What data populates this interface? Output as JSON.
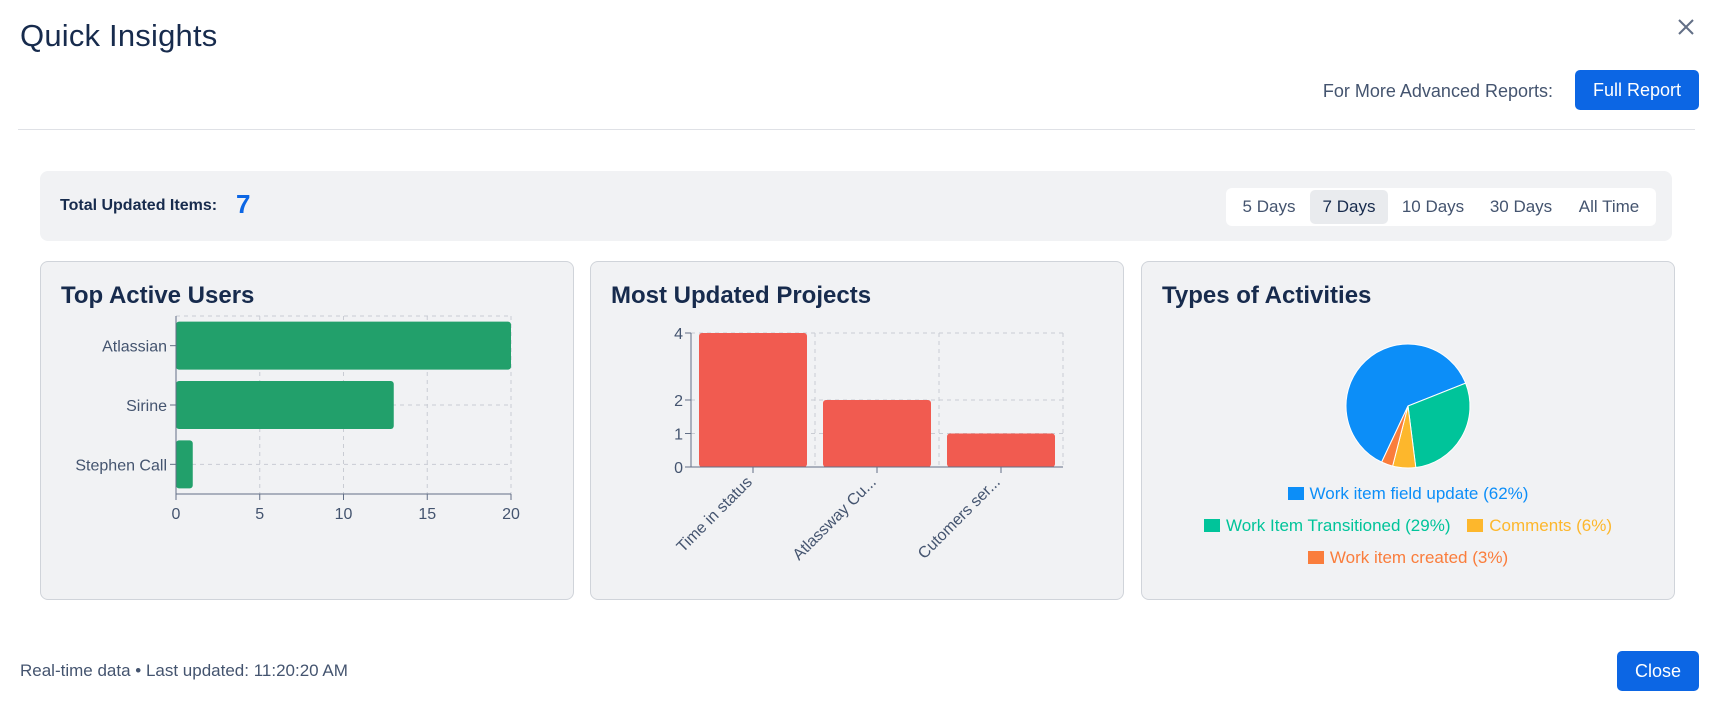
{
  "dialog": {
    "title": "Quick Insights",
    "advanced_label": "For More Advanced Reports:",
    "full_report_label": "Full Report",
    "close_label": "Close",
    "footer": "Real-time data • Last updated: 11:20:20 AM"
  },
  "summary": {
    "label": "Total Updated Items:",
    "value": "7",
    "ranges": [
      "5 Days",
      "7 Days",
      "10 Days",
      "30 Days",
      "All Time"
    ],
    "active_range": "7 Days"
  },
  "colors": {
    "primary": "#0c66e4",
    "users_bar": "#22a06b",
    "projects_bar": "#f15b50"
  },
  "chart_data": [
    {
      "type": "bar",
      "orientation": "horizontal",
      "title": "Top Active Users",
      "categories": [
        "Atlassian",
        "Sirine",
        "Stephen Call"
      ],
      "values": [
        20,
        13,
        1
      ],
      "xlim": [
        0,
        20
      ],
      "xticks": [
        0,
        5,
        10,
        15,
        20
      ],
      "grid": true,
      "color": "#22a06b"
    },
    {
      "type": "bar",
      "title": "Most Updated Projects",
      "categories": [
        "Time in status",
        "Atlassway Cu...",
        "Cutomers ser..."
      ],
      "values": [
        4,
        2,
        1
      ],
      "ylim": [
        0,
        4
      ],
      "yticks": [
        0,
        1,
        2,
        4
      ],
      "grid": true,
      "color": "#f15b50"
    },
    {
      "type": "pie",
      "title": "Types of Activities",
      "slices": [
        {
          "label": "Work item field update (62%)",
          "value": 62,
          "color": "#0c8ef8"
        },
        {
          "label": "Work Item Transitioned (29%)",
          "value": 29,
          "color": "#00c49a"
        },
        {
          "label": "Comments (6%)",
          "value": 6,
          "color": "#fdb72c"
        },
        {
          "label": "Work item created (3%)",
          "value": 3,
          "color": "#fa7d3c"
        }
      ],
      "legend": "bottom"
    }
  ]
}
